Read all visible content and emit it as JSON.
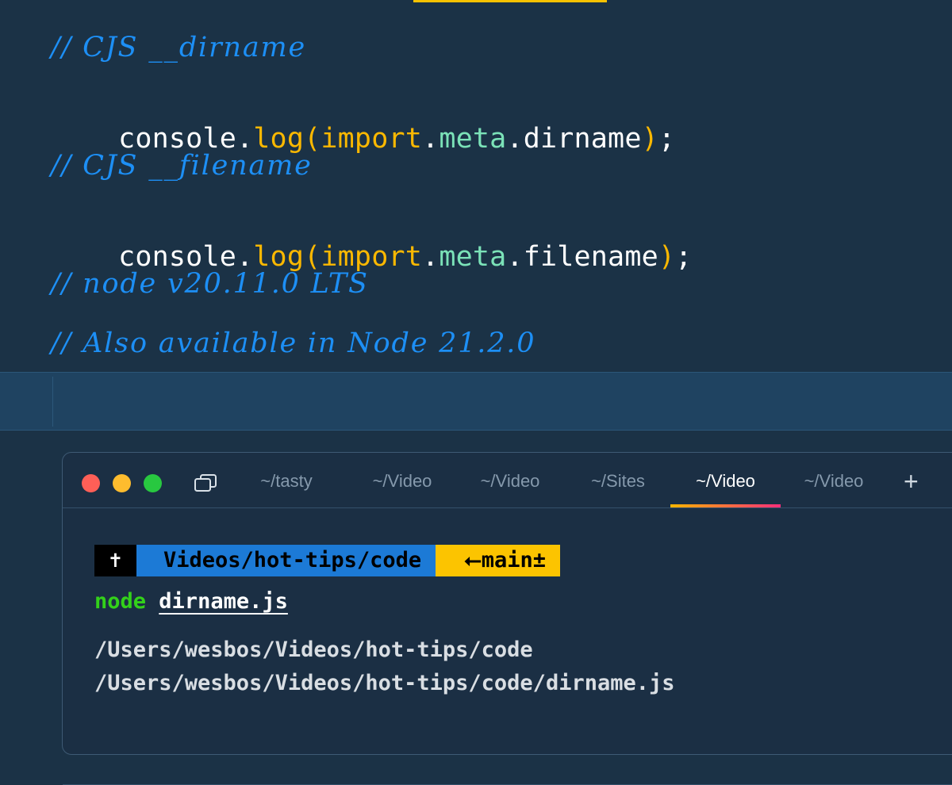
{
  "editor": {
    "lines": [
      {
        "type": "comment",
        "text": "// CJS __dirname"
      },
      {
        "type": "code",
        "tokens": [
          {
            "kind": "ident",
            "text": "console"
          },
          {
            "kind": "punct",
            "text": "."
          },
          {
            "kind": "fn",
            "text": "log"
          },
          {
            "kind": "paren",
            "text": "("
          },
          {
            "kind": "kw",
            "text": "import"
          },
          {
            "kind": "punct",
            "text": "."
          },
          {
            "kind": "meta",
            "text": "meta"
          },
          {
            "kind": "punct",
            "text": "."
          },
          {
            "kind": "ident",
            "text": "dirname"
          },
          {
            "kind": "paren",
            "text": ")"
          },
          {
            "kind": "punct",
            "text": ";"
          }
        ]
      },
      {
        "type": "comment",
        "text": "// CJS __filename"
      },
      {
        "type": "code",
        "tokens": [
          {
            "kind": "ident",
            "text": "console"
          },
          {
            "kind": "punct",
            "text": "."
          },
          {
            "kind": "fn",
            "text": "log"
          },
          {
            "kind": "paren",
            "text": "("
          },
          {
            "kind": "kw",
            "text": "import"
          },
          {
            "kind": "punct",
            "text": "."
          },
          {
            "kind": "meta",
            "text": "meta"
          },
          {
            "kind": "punct",
            "text": "."
          },
          {
            "kind": "ident",
            "text": "filename"
          },
          {
            "kind": "paren",
            "text": ")"
          },
          {
            "kind": "punct",
            "text": ";"
          }
        ]
      },
      {
        "type": "comment",
        "text": "// node v20.11.0 LTS"
      },
      {
        "type": "comment",
        "text": "// Also available in Node 21.2.0"
      }
    ],
    "colors": {
      "background": "#1b3246",
      "comment": "#1d8ff5",
      "function": "#fbb800",
      "meta": "#7be2b8",
      "text": "#ffffff"
    }
  },
  "terminal": {
    "traffic_lights": [
      "close",
      "minimize",
      "zoom"
    ],
    "tabs": [
      {
        "label": "~/tasty",
        "active": false
      },
      {
        "label": "~/Video",
        "active": false
      },
      {
        "label": "~/Video",
        "active": false
      },
      {
        "label": "~/Sites",
        "active": false
      },
      {
        "label": "~/Video",
        "active": true
      },
      {
        "label": "~/Video",
        "active": false
      }
    ],
    "new_tab_label": "+",
    "prompt": {
      "root_symbol": "✝",
      "path": "Videos/hot-tips/code",
      "branch": "⭠main±"
    },
    "command": {
      "bin": "node",
      "arg": "dirname.js"
    },
    "output": [
      "/Users/wesbos/Videos/hot-tips/code",
      "/Users/wesbos/Videos/hot-tips/code/dirname.js"
    ],
    "colors": {
      "path_segment": "#1c7ad6",
      "branch_segment": "#fcc400",
      "command": "#33d11a"
    }
  }
}
